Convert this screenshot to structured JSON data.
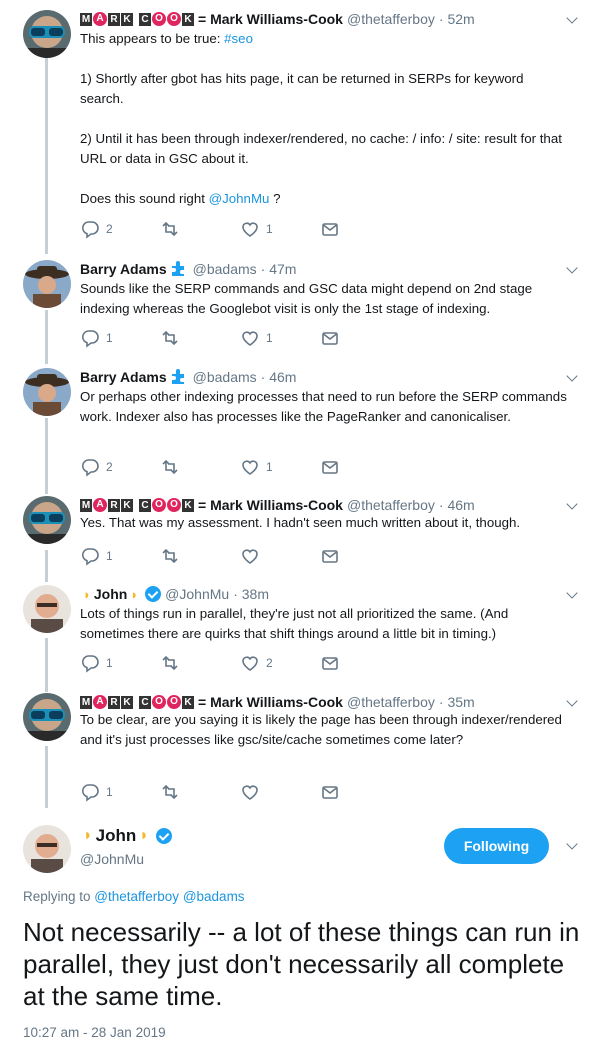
{
  "colors": {
    "accent": "#1da1f2",
    "link": "#1b95e0",
    "muted": "#657786",
    "connector": "#c4cfd6"
  },
  "logo_letters": [
    "M",
    "A",
    "R",
    "K",
    "C",
    "O",
    "O",
    "K"
  ],
  "tweets": [
    {
      "name": "= Mark Williams-Cook",
      "handle": "@thetafferboy",
      "time": "· 52m",
      "text_prefix": "This appears to be true: ",
      "hashtag": "#seo",
      "text_mid": "\n\n1) Shortly after gbot has hits page, it can be returned in SERPs for keyword search.\n\n2) Until it has been through indexer/rendered, no cache: / info: / site: result for that URL or data in GSC about it.\n\nDoes this sound right ",
      "mention": "@JohnMu",
      "text_suffix": " ?",
      "replies": "2",
      "retweets": "",
      "likes": "1"
    },
    {
      "name": "Barry Adams",
      "handle": "@badams",
      "time": "· 47m",
      "text": "Sounds like the SERP commands and GSC data might depend on 2nd stage indexing whereas the Googlebot visit is only the 1st stage of indexing.",
      "replies": "1",
      "retweets": "",
      "likes": "1"
    },
    {
      "name": "Barry Adams",
      "handle": "@badams",
      "time": "· 46m",
      "text": "Or perhaps other indexing processes that need to run before the SERP commands work. Indexer also has processes like the PageRanker and canonicaliser.",
      "replies": "2",
      "retweets": "",
      "likes": "1"
    },
    {
      "name": "= Mark Williams-Cook",
      "handle": "@thetafferboy",
      "time": "· 46m",
      "text": "Yes. That was my assessment. I hadn't seen much written about it, though.",
      "replies": "1",
      "retweets": "",
      "likes": ""
    },
    {
      "name": "John",
      "handle": "@JohnMu",
      "time": "· 38m",
      "text": "Lots of things run in parallel, they're just not all prioritized the same. (And sometimes there are quirks that shift things around a little bit in timing.)",
      "replies": "1",
      "retweets": "",
      "likes": "2"
    },
    {
      "name": "= Mark Williams-Cook",
      "handle": "@thetafferboy",
      "time": "· 35m",
      "text": "To be clear, are you saying it is likely the page has been through indexer/rendered and it's just processes like gsc/site/cache sometimes come later?",
      "replies": "1",
      "retweets": "",
      "likes": ""
    }
  ],
  "main": {
    "name": "John",
    "handle": "@JohnMu",
    "follow_label": "Following",
    "replying_prefix": "Replying to ",
    "replying_to_1": "@thetafferboy",
    "replying_to_2": "@badams",
    "text": "Not necessarily -- a lot of these things can run in parallel, they just don't necessarily all complete at the same time.",
    "timestamp": "10:27 am - 28 Jan 2019"
  }
}
